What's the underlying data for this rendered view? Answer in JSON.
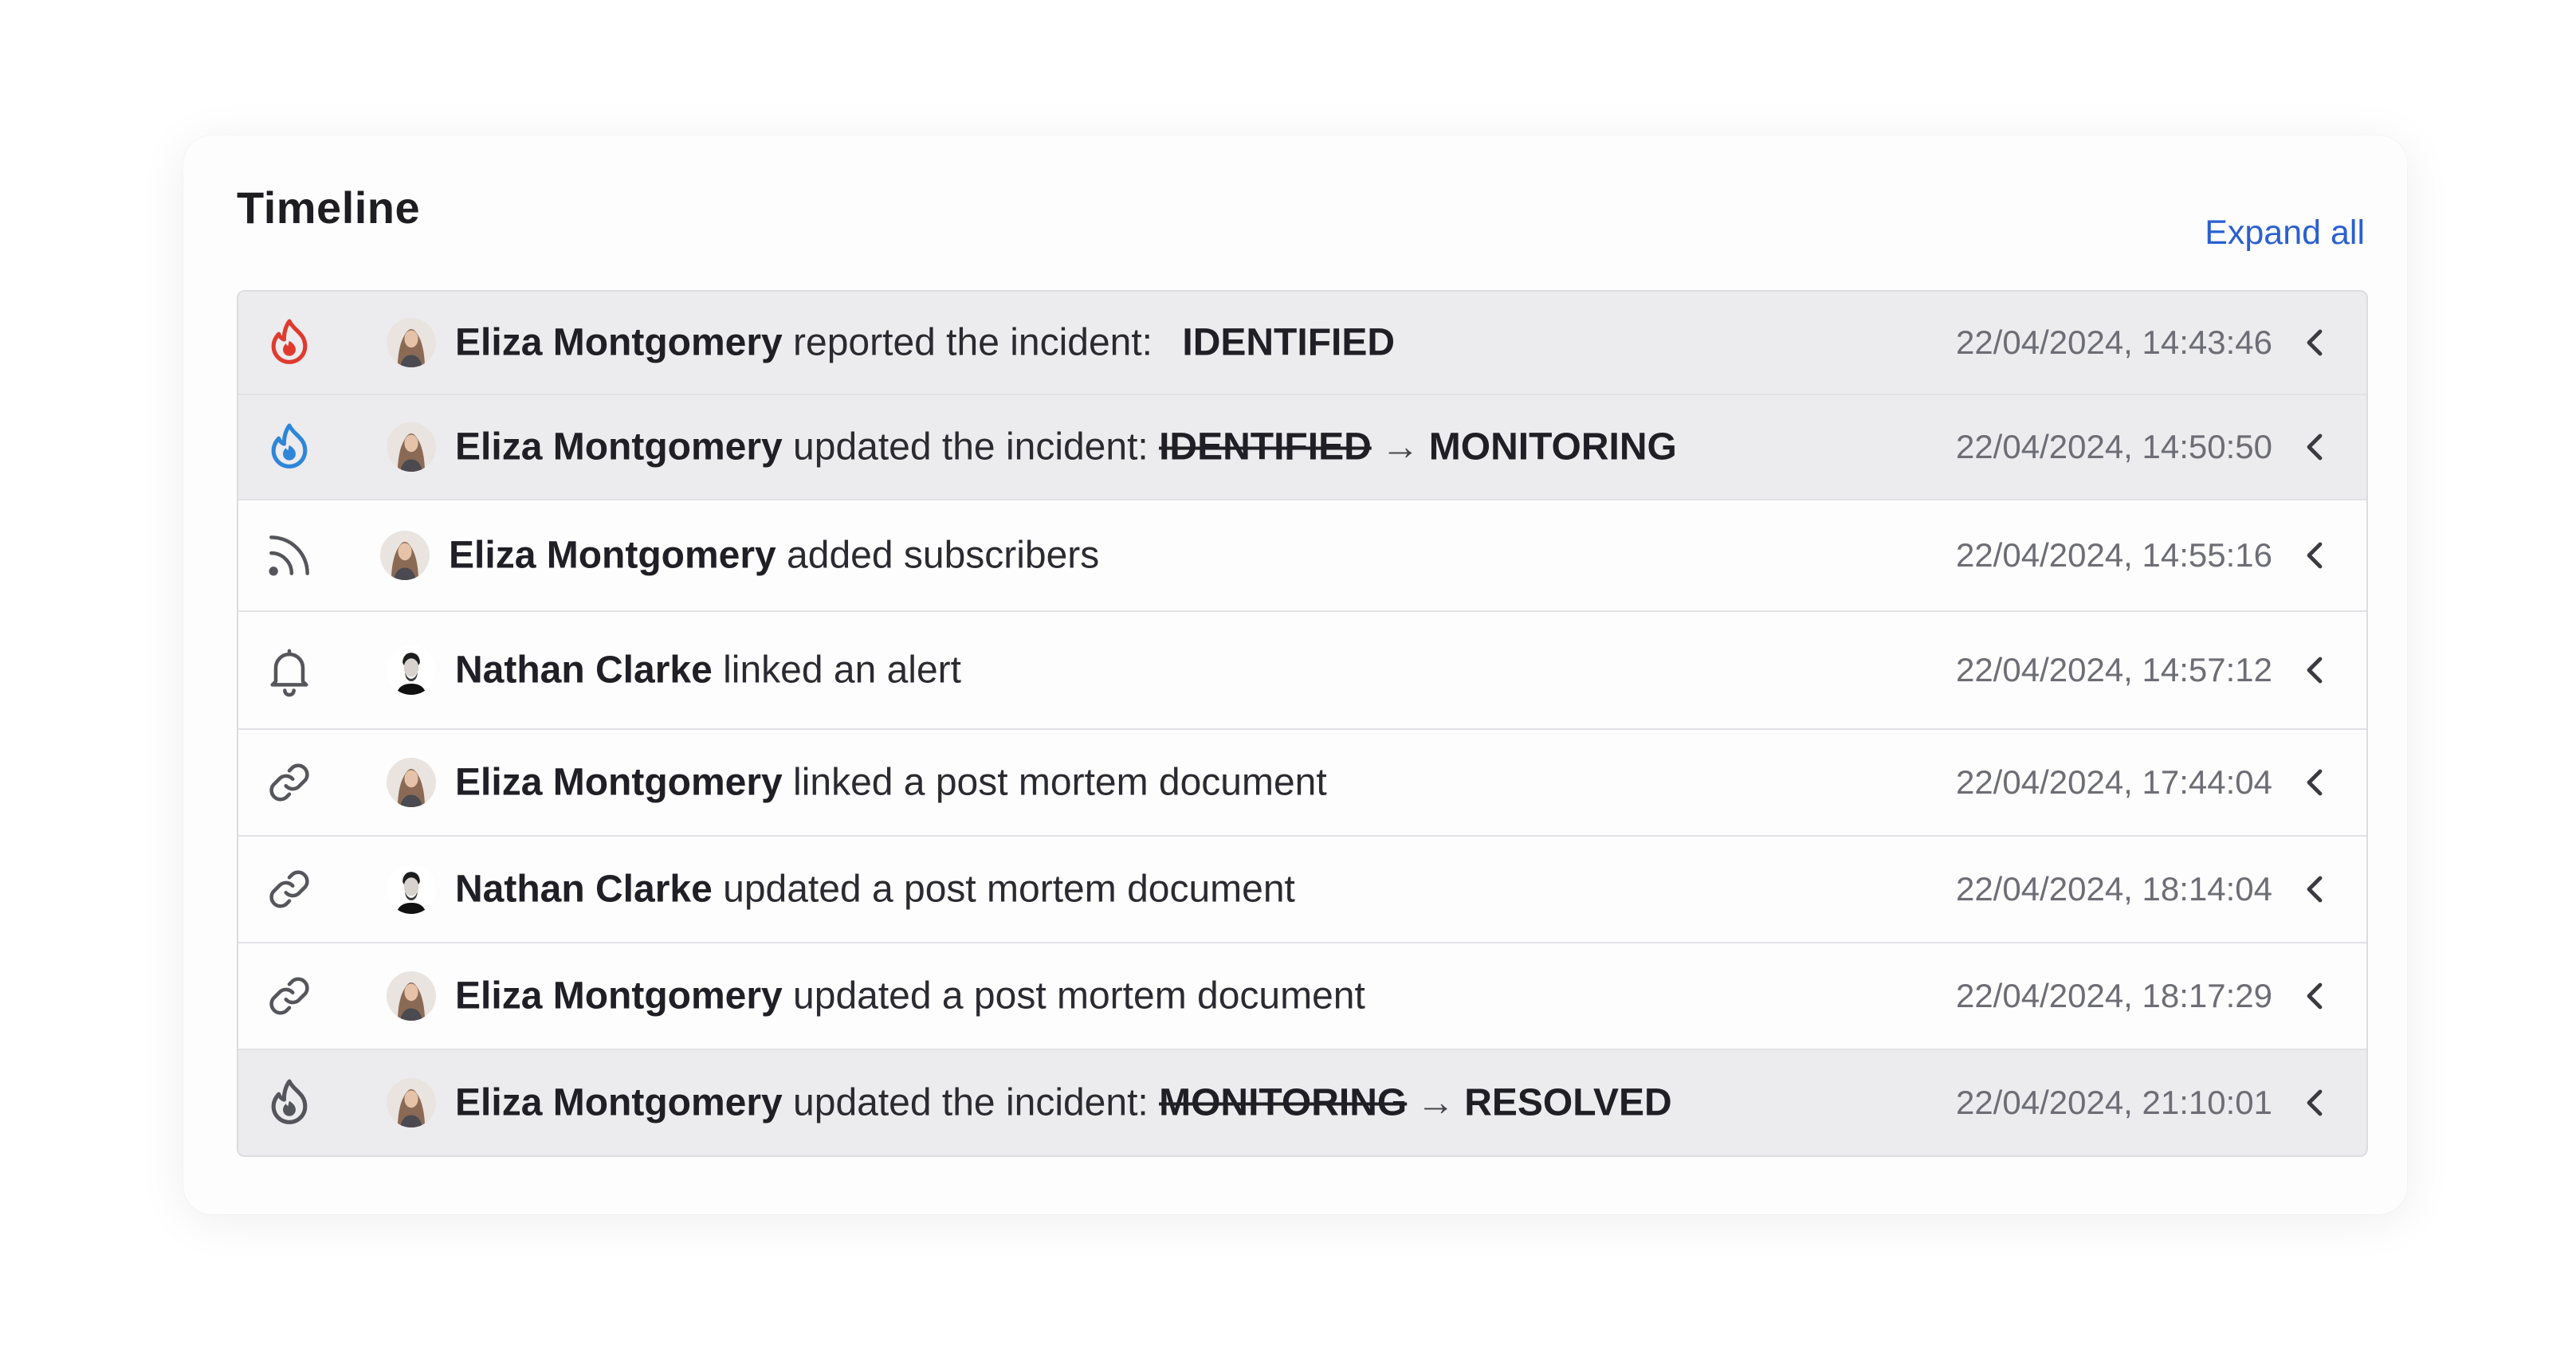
{
  "timeline": {
    "title": "Timeline",
    "expand_all_label": "Expand all",
    "items": [
      {
        "icon": "flame-icon",
        "icon_color": "#e03a2f",
        "avatar": "eliza-avatar",
        "name": "Eliza Montgomery",
        "action": " reported the incident: ",
        "from": "",
        "arrow": "",
        "to": "IDENTIFIED",
        "time": "22/04/2024, 14:43:46",
        "status": true
      },
      {
        "icon": "flame-icon",
        "icon_color": "#2e86d8",
        "avatar": "eliza-avatar",
        "name": "Eliza Montgomery",
        "action": " updated the incident: ",
        "from": "IDENTIFIED",
        "arrow": "→",
        "to": "MONITORING",
        "time": "22/04/2024, 14:50:50",
        "status": true
      },
      {
        "icon": "rss-icon",
        "icon_color": "#55555c",
        "avatar": "eliza-avatar",
        "name": "Eliza Montgomery",
        "action": " added subscribers",
        "from": "",
        "arrow": "",
        "to": "",
        "time": "22/04/2024, 14:55:16",
        "status": false
      },
      {
        "icon": "bell-icon",
        "icon_color": "#55555c",
        "avatar": "nathan-avatar",
        "name": "Nathan Clarke",
        "action": " linked an alert",
        "from": "",
        "arrow": "",
        "to": "",
        "time": "22/04/2024, 14:57:12",
        "status": false
      },
      {
        "icon": "link-icon",
        "icon_color": "#55555c",
        "avatar": "eliza-avatar",
        "name": "Eliza Montgomery",
        "action": " linked a post mortem document",
        "from": "",
        "arrow": "",
        "to": "",
        "time": "22/04/2024, 17:44:04",
        "status": false
      },
      {
        "icon": "link-icon",
        "icon_color": "#55555c",
        "avatar": "nathan-avatar",
        "name": "Nathan Clarke",
        "action": " updated a post mortem document",
        "from": "",
        "arrow": "",
        "to": "",
        "time": "22/04/2024, 18:14:04",
        "status": false
      },
      {
        "icon": "link-icon",
        "icon_color": "#55555c",
        "avatar": "eliza-avatar",
        "name": "Eliza Montgomery",
        "action": " updated a post mortem document",
        "from": "",
        "arrow": "",
        "to": "",
        "time": "22/04/2024, 18:17:29",
        "status": false
      },
      {
        "icon": "flame-icon",
        "icon_color": "#55555c",
        "avatar": "eliza-avatar",
        "name": "Eliza Montgomery",
        "action": " updated the incident: ",
        "from": "MONITORING",
        "arrow": "→",
        "to": "RESOLVED",
        "time": "22/04/2024, 21:10:01",
        "status": true
      }
    ]
  }
}
